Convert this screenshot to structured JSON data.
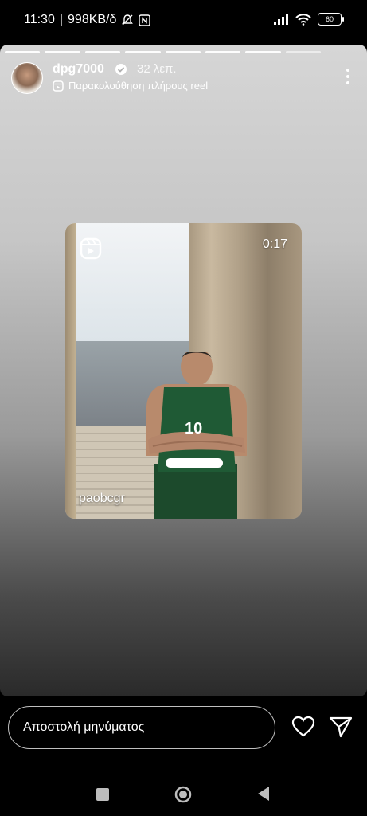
{
  "status_bar": {
    "time": "11:30",
    "network_speed": "998KB/δ",
    "battery_level": "60",
    "icons": [
      "mute-icon",
      "nfc-icon",
      "signal-icon",
      "wifi-icon",
      "battery-icon"
    ]
  },
  "story": {
    "progress_segments": 8,
    "progress_active": 7,
    "username": "dpg7000",
    "posted_ago": "32 λεπ.",
    "reel_link_label": "Παρακολούθηση πλήρους reel",
    "reel": {
      "duration": "0:17",
      "author": "paobcgr"
    }
  },
  "bottom_bar": {
    "message_placeholder": "Αποστολή μηνύματος"
  },
  "colors": {
    "background": "#000000",
    "text": "#ffffff",
    "jersey_green": "#1f5a35"
  }
}
